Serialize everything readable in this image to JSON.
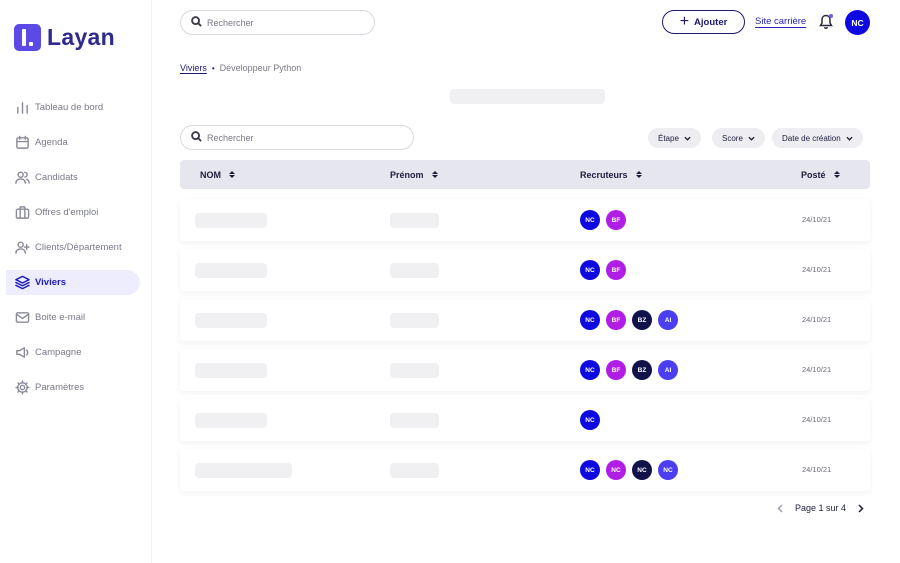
{
  "app": {
    "logo_text": "Layan"
  },
  "sidebar": {
    "items": [
      {
        "label": "Tableau de bord",
        "icon": "chart-bar-icon",
        "active": false
      },
      {
        "label": "Agenda",
        "icon": "calendar-icon",
        "active": false
      },
      {
        "label": "Candidats",
        "icon": "users-icon",
        "active": false
      },
      {
        "label": "Offres d'emploi",
        "icon": "briefcase-icon",
        "active": false
      },
      {
        "label": "Clients/Département",
        "icon": "user-plus-icon",
        "active": false
      },
      {
        "label": "Viviers",
        "icon": "layers-icon",
        "active": true
      },
      {
        "label": "Boite e-mail",
        "icon": "mail-icon",
        "active": false
      },
      {
        "label": "Campagne",
        "icon": "megaphone-icon",
        "active": false
      },
      {
        "label": "Paramètres",
        "icon": "settings-icon",
        "active": false
      }
    ]
  },
  "header": {
    "search_placeholder": "Rechercher",
    "add_button_label": "Ajouter",
    "career_site_link": "Site carrière",
    "user_initials": "NC"
  },
  "breadcrumb": {
    "parent": "Viviers",
    "current": "Développeur Python"
  },
  "table_search": {
    "placeholder": "Rechercher"
  },
  "filters": {
    "stage": "Étape",
    "score": "Score",
    "created_date": "Date de création"
  },
  "table": {
    "columns": {
      "nom": "NOM",
      "prenom": "Prénom",
      "recruiters": "Recruteurs",
      "posted": "Posté"
    },
    "rows": [
      {
        "recruiters": [
          "NC",
          "BF"
        ],
        "posted": "24/10/21"
      },
      {
        "recruiters": [
          "NC",
          "BF"
        ],
        "posted": "24/10/21"
      },
      {
        "recruiters": [
          "NC",
          "BF",
          "BZ",
          "AI"
        ],
        "posted": "24/10/21"
      },
      {
        "recruiters": [
          "NC",
          "BF",
          "BZ",
          "AI"
        ],
        "posted": "24/10/21"
      },
      {
        "recruiters": [
          "NC"
        ],
        "posted": "24/10/21"
      },
      {
        "recruiters": [
          "NC",
          "NC",
          "NC",
          "NC"
        ],
        "posted": "24/10/21"
      }
    ]
  },
  "avatar_colors": {
    "NC": "#0d09e0",
    "BF": "#b01ee6",
    "BZ": "#12124a",
    "AI": "#4a3ef0"
  },
  "pagination": {
    "label": "Page 1 sur 4"
  },
  "colors": {
    "accent": "#1d1ab8",
    "brand": "#5b4ae6",
    "active_bg": "#eeedfd"
  }
}
